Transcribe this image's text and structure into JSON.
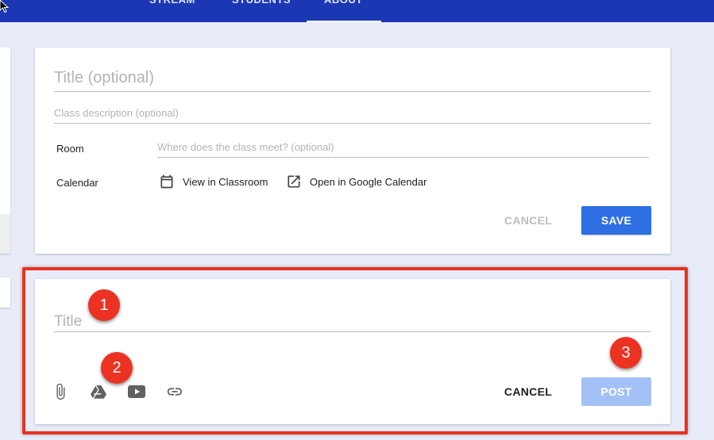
{
  "colors": {
    "app_bar": "#1c37b3",
    "background": "#e8ecf9",
    "primary_button": "#2e6fe3",
    "primary_button_disabled": "#a3c1f6",
    "annotation_red": "#e8321f"
  },
  "nav": {
    "tabs": [
      {
        "label": "STREAM"
      },
      {
        "label": "STUDENTS"
      },
      {
        "label": "ABOUT",
        "active": true
      }
    ]
  },
  "about_card": {
    "title_placeholder": "Title (optional)",
    "description_placeholder": "Class description (optional)",
    "room_label": "Room",
    "room_placeholder": "Where does the class meet? (optional)",
    "calendar_label": "Calendar",
    "view_in_classroom": "View in Classroom",
    "open_in_google_calendar": "Open in Google Calendar",
    "cancel_label": "CANCEL",
    "save_label": "SAVE"
  },
  "post_card": {
    "title_placeholder": "Title",
    "attach_icons": [
      "attachment-icon",
      "google-drive-icon",
      "youtube-icon",
      "link-icon"
    ],
    "cancel_label": "CANCEL",
    "post_label": "POST"
  },
  "annotations": [
    "1",
    "2",
    "3"
  ]
}
